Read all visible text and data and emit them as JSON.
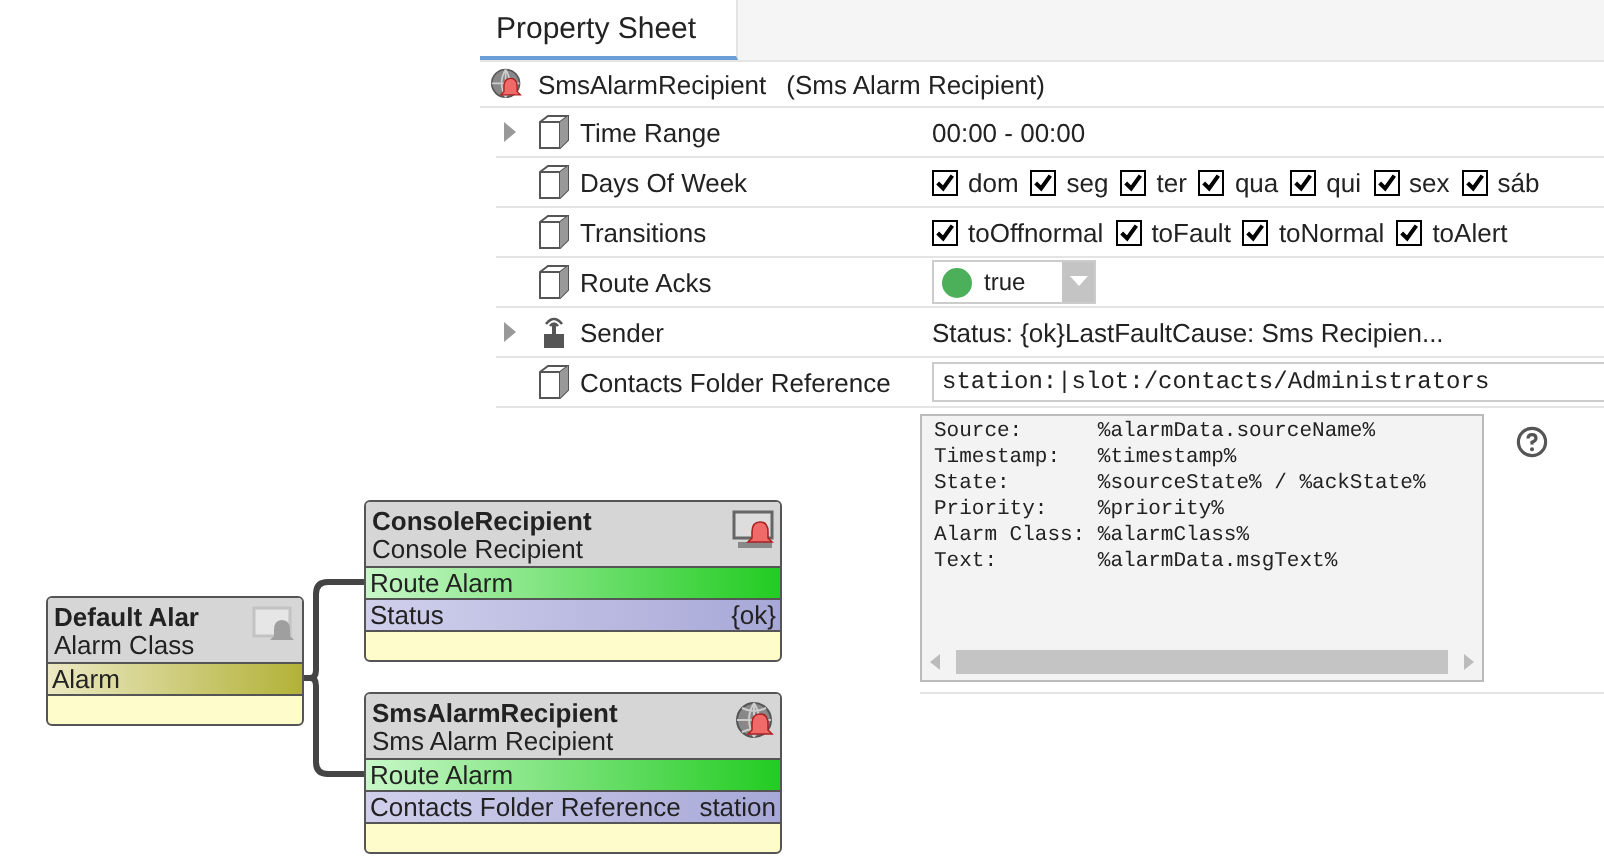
{
  "panel": {
    "tab": {
      "label": "Property Sheet",
      "selected": true
    },
    "object": {
      "name": "SmsAlarmRecipient",
      "type": "(Sms Alarm Recipient)"
    },
    "properties": [
      {
        "kind": "text",
        "label": "Time Range",
        "expandable": true,
        "value": "00:00 - 00:00"
      },
      {
        "kind": "checkboxes",
        "label": "Days Of Week",
        "expandable": false,
        "options": [
          {
            "label": "dom",
            "checked": true
          },
          {
            "label": "seg",
            "checked": true
          },
          {
            "label": "ter",
            "checked": true
          },
          {
            "label": "qua",
            "checked": true
          },
          {
            "label": "qui",
            "checked": true
          },
          {
            "label": "sex",
            "checked": true
          },
          {
            "label": "sáb",
            "checked": true
          }
        ]
      },
      {
        "kind": "checkboxes",
        "label": "Transitions",
        "expandable": false,
        "options": [
          {
            "label": "toOffnormal",
            "checked": true
          },
          {
            "label": "toFault",
            "checked": true
          },
          {
            "label": "toNormal",
            "checked": true
          },
          {
            "label": "toAlert",
            "checked": true
          }
        ]
      },
      {
        "kind": "dropdown",
        "label": "Route Acks",
        "expandable": false,
        "value": "true",
        "on": true
      },
      {
        "kind": "text",
        "label": "Sender",
        "expandable": true,
        "value": "Status: {ok}LastFaultCause: Sms Recipien..."
      },
      {
        "kind": "field",
        "label": "Contacts Folder Reference",
        "expandable": false,
        "value": "station:|slot:/contacts/Administrators"
      },
      {
        "kind": "textarea",
        "lines": [
          "Source:      %alarmData.sourceName%",
          "Timestamp:   %timestamp%",
          "State:       %sourceState% / %ackState%",
          "Priority:    %priority%",
          "Alarm Class: %alarmClass%",
          "Text:        %alarmData.msgText%"
        ]
      }
    ]
  },
  "wiresheet": {
    "nodes": [
      {
        "title": "Default Alar",
        "subtitle": "Alarm Class",
        "slots": [
          {
            "kind": "topic",
            "name": "Alarm"
          }
        ]
      },
      {
        "title": "ConsoleRecipient",
        "subtitle": "Console Recipient",
        "slots": [
          {
            "kind": "action",
            "name": "Route Alarm"
          },
          {
            "kind": "property",
            "name": "Status",
            "value": "{ok}"
          }
        ]
      },
      {
        "title": "SmsAlarmRecipient",
        "subtitle": "Sms Alarm Recipient",
        "slots": [
          {
            "kind": "action",
            "name": "Route Alarm"
          },
          {
            "kind": "property",
            "name": "Contacts Folder Reference",
            "value": "station"
          }
        ]
      }
    ]
  }
}
